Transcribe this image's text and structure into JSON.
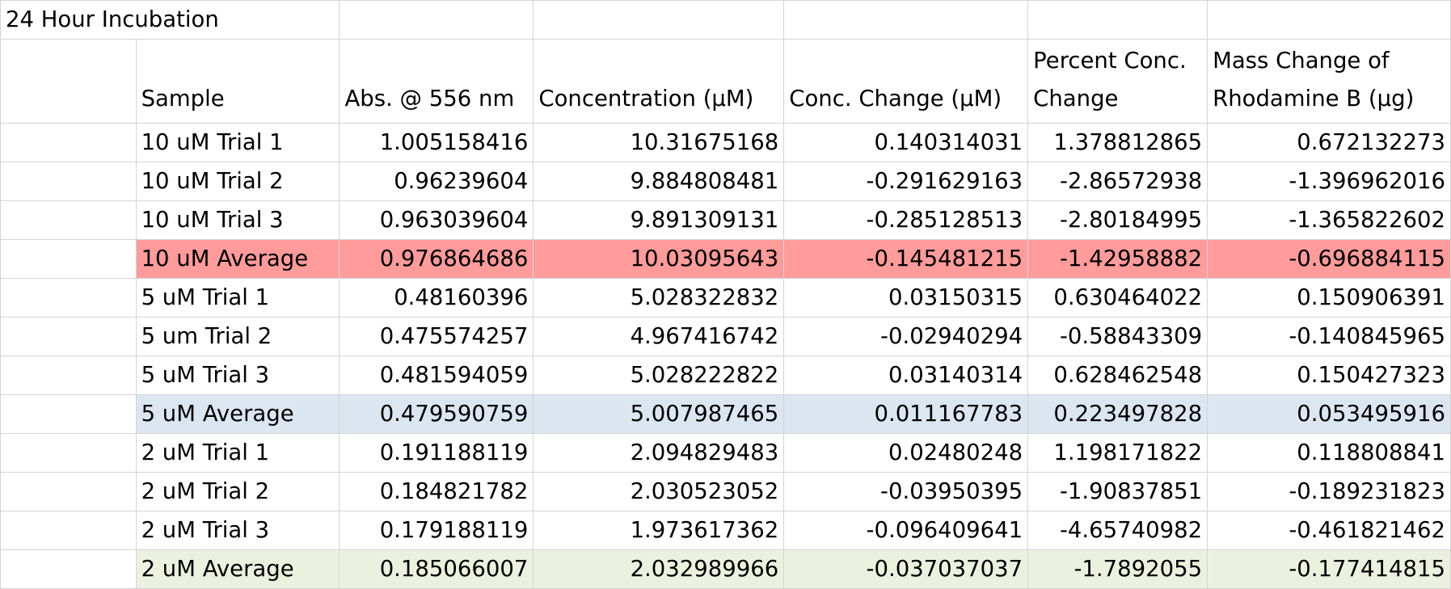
{
  "title": "24 Hour Incubation",
  "headers": {
    "sample": "Sample",
    "abs": "Abs. @ 556 nm",
    "conc": "Concentration (µM)",
    "conc_change": "Conc. Change (µM)",
    "pct_line1": "Percent Conc.",
    "pct_line2": "Change",
    "mass_line1": "Mass Change of",
    "mass_line2": "Rhodamine B (µg)"
  },
  "rows": [
    {
      "sample": "10 uM Trial 1",
      "abs": "1.005158416",
      "conc": "10.31675168",
      "conc_change": "0.140314031",
      "pct": "1.378812865",
      "mass": "0.672132273"
    },
    {
      "sample": "10 uM Trial 2",
      "abs": "0.96239604",
      "conc": "9.884808481",
      "conc_change": "-0.291629163",
      "pct": "-2.86572938",
      "mass": "-1.396962016"
    },
    {
      "sample": "10 uM Trial 3",
      "abs": "0.963039604",
      "conc": "9.891309131",
      "conc_change": "-0.285128513",
      "pct": "-2.80184995",
      "mass": "-1.365822602"
    },
    {
      "sample": "10 uM Average",
      "abs": "0.976864686",
      "conc": "10.03095643",
      "conc_change": "-0.145481215",
      "pct": "-1.42958882",
      "mass": "-0.696884115"
    },
    {
      "sample": "5 uM Trial 1",
      "abs": "0.48160396",
      "conc": "5.028322832",
      "conc_change": "0.03150315",
      "pct": "0.630464022",
      "mass": "0.150906391"
    },
    {
      "sample": "5 um Trial 2",
      "abs": "0.475574257",
      "conc": "4.967416742",
      "conc_change": "-0.02940294",
      "pct": "-0.58843309",
      "mass": "-0.140845965"
    },
    {
      "sample": "5 uM Trial 3",
      "abs": "0.481594059",
      "conc": "5.028222822",
      "conc_change": "0.03140314",
      "pct": "0.628462548",
      "mass": "0.150427323"
    },
    {
      "sample": "5 uM Average",
      "abs": "0.479590759",
      "conc": "5.007987465",
      "conc_change": "0.011167783",
      "pct": "0.223497828",
      "mass": "0.053495916"
    },
    {
      "sample": "2 uM Trial 1",
      "abs": "0.191188119",
      "conc": "2.094829483",
      "conc_change": "0.02480248",
      "pct": "1.198171822",
      "mass": "0.118808841"
    },
    {
      "sample": "2 uM Trial 2",
      "abs": "0.184821782",
      "conc": "2.030523052",
      "conc_change": "-0.03950395",
      "pct": "-1.90837851",
      "mass": "-0.189231823"
    },
    {
      "sample": "2 uM Trial 3",
      "abs": "0.179188119",
      "conc": "1.973617362",
      "conc_change": "-0.096409641",
      "pct": "-4.65740982",
      "mass": "-0.461821462"
    },
    {
      "sample": "2 uM Average",
      "abs": "0.185066007",
      "conc": "2.032989966",
      "conc_change": "-0.037037037",
      "pct": "-1.7892055",
      "mass": "-0.177414815"
    }
  ],
  "colors": {
    "avg_10": "#ff9b9b",
    "avg_5": "#dce6f1",
    "avg_2": "#ebf1de",
    "gridline": "#d4d4d4"
  }
}
